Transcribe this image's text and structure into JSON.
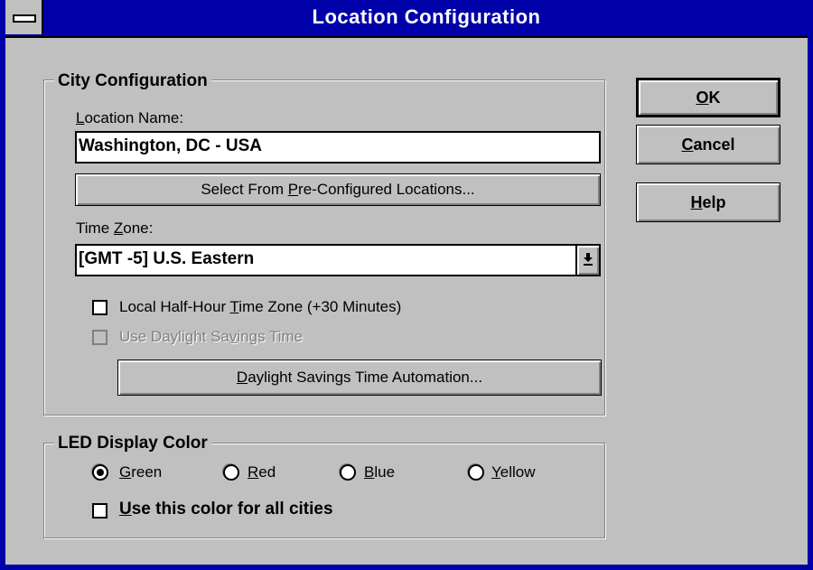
{
  "window": {
    "title": "Location Configuration"
  },
  "city_group": {
    "legend": "City Configuration",
    "location_label": {
      "pre": "",
      "key": "L",
      "post": "ocation Name:"
    },
    "location_value": "Washington, DC - USA",
    "select_button": {
      "pre": "Select From ",
      "key": "P",
      "post": "re-Configured Locations..."
    },
    "timezone_label": {
      "pre": "Time ",
      "key": "Z",
      "post": "one:"
    },
    "timezone_value": "[GMT -5] U.S. Eastern",
    "half_hour": {
      "pre": "Local Half-Hour ",
      "key": "T",
      "post": "ime Zone (+30 Minutes)",
      "checked": false
    },
    "dst": {
      "pre": "Use Daylight Sa",
      "key": "v",
      "post": "ings Time",
      "checked": false,
      "enabled": false
    },
    "dst_button": {
      "pre": "",
      "key": "D",
      "post": "aylight Savings Time Automation..."
    }
  },
  "led_group": {
    "legend": "LED Display Color",
    "radios": [
      {
        "key": "G",
        "post": "reen",
        "selected": true
      },
      {
        "key": "R",
        "post": "ed",
        "selected": false
      },
      {
        "key": "B",
        "post": "lue",
        "selected": false
      },
      {
        "key": "Y",
        "post": "ellow",
        "selected": false
      }
    ],
    "all_cities": {
      "key": "U",
      "post": "se this color for all cities",
      "checked": false
    }
  },
  "buttons": {
    "ok": {
      "key": "O",
      "post": "K"
    },
    "cancel": {
      "key": "C",
      "post": "ancel"
    },
    "help": {
      "key": "H",
      "post": "elp"
    }
  },
  "colors": {
    "title_bar": "#0000a8",
    "face": "#c0c0c0",
    "disabled_text": "#808080"
  }
}
